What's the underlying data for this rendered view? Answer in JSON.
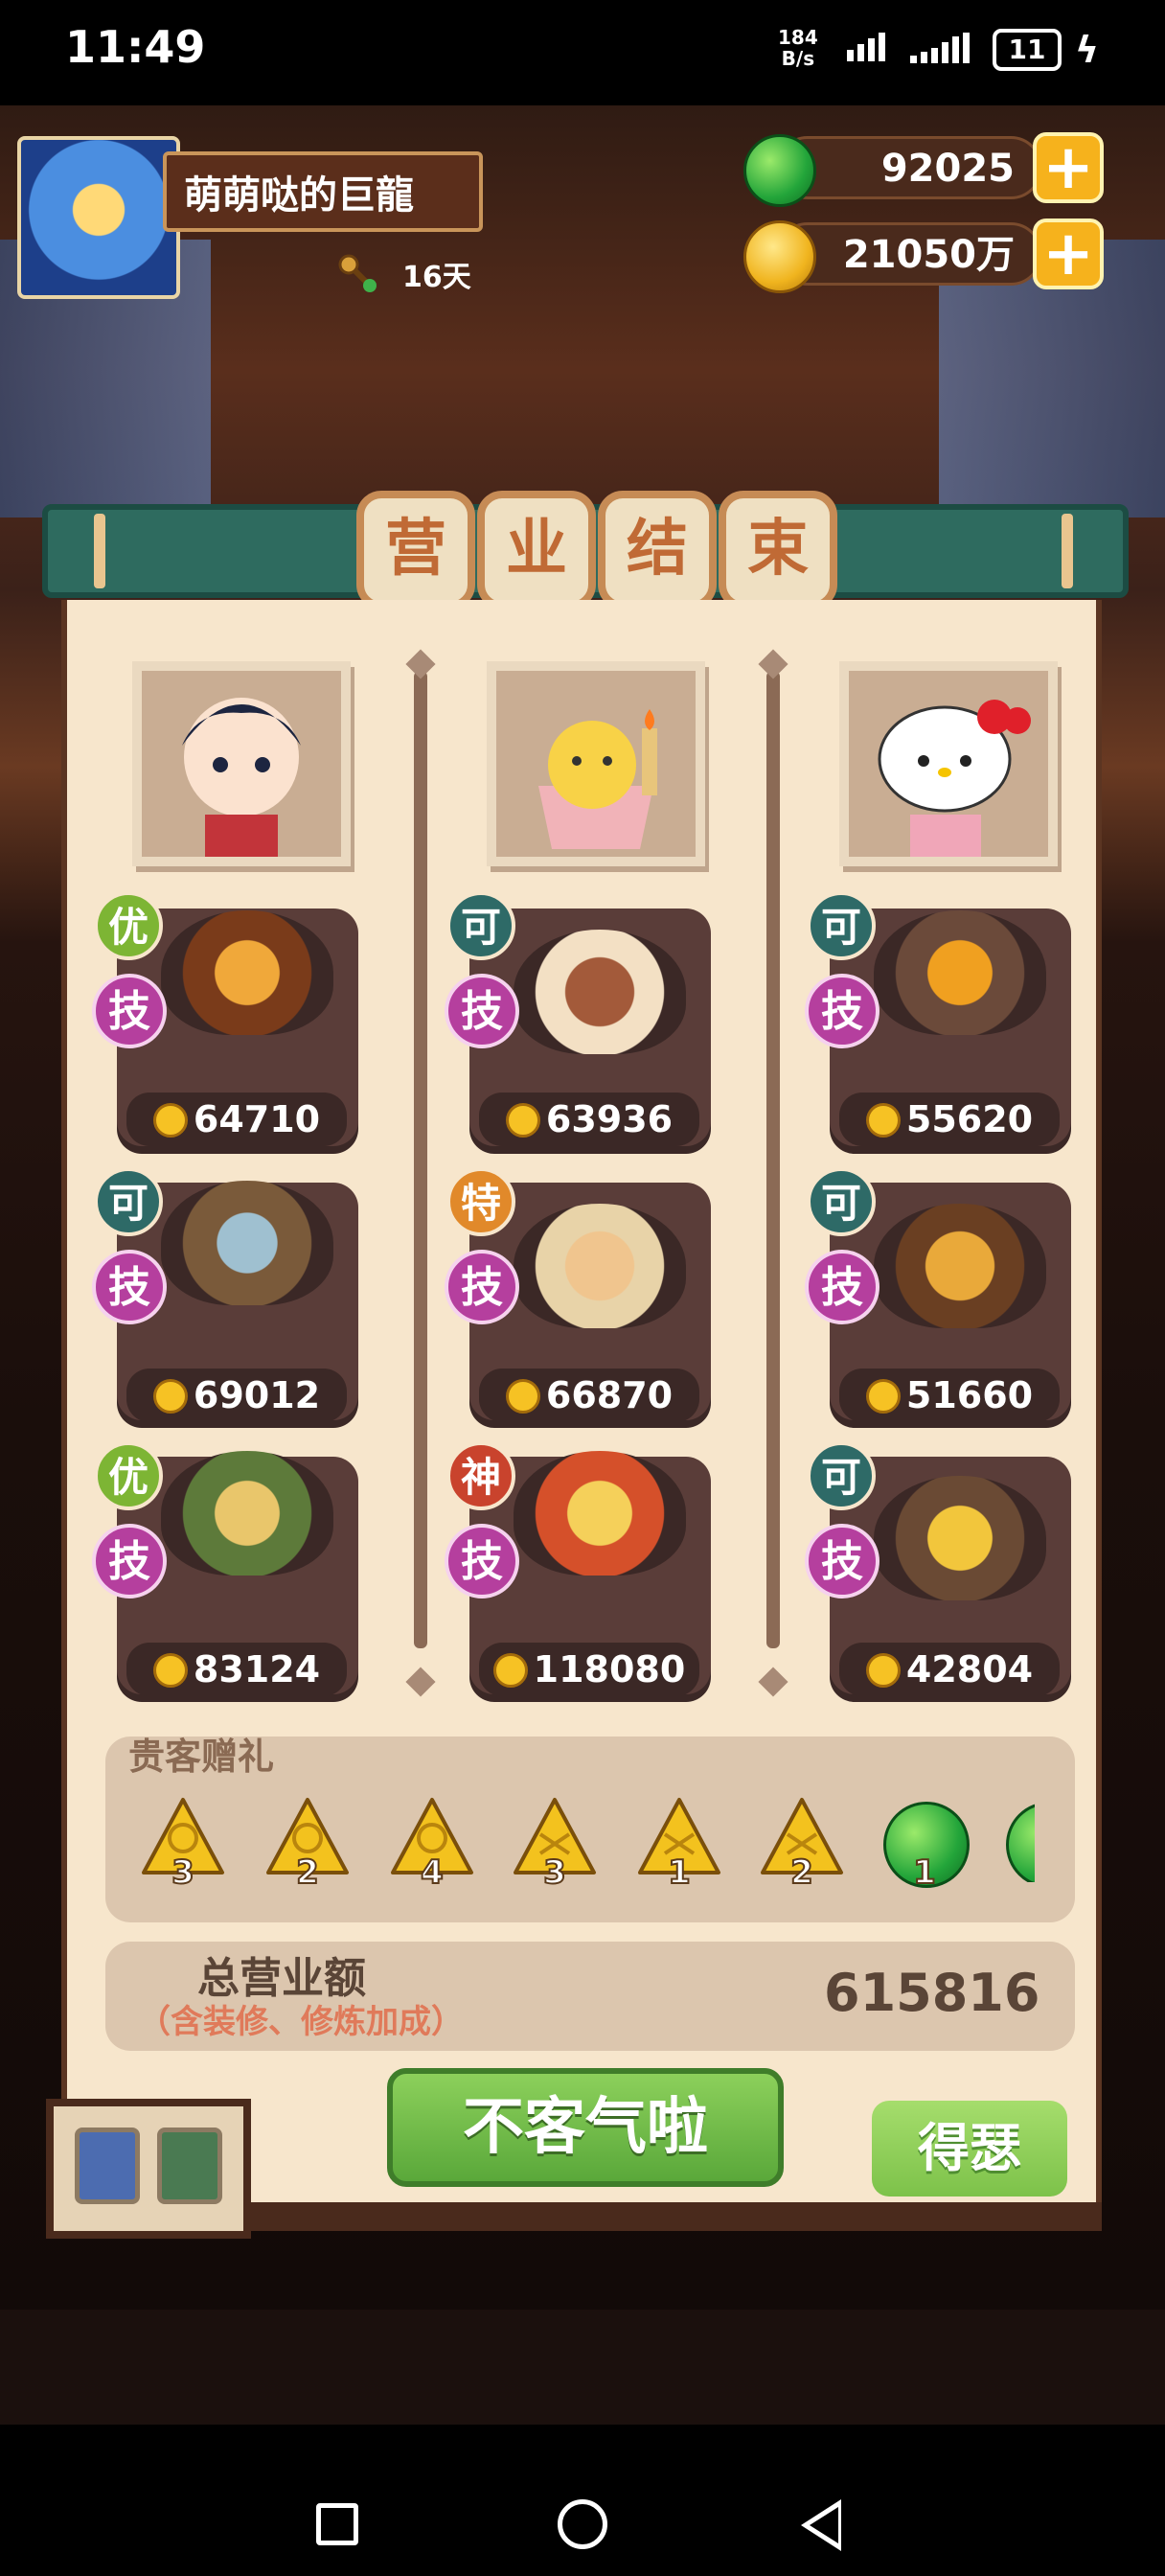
{
  "status_bar": {
    "time": "11:49",
    "net_speed_top": "184",
    "net_speed_unit": "B/s",
    "battery": "11"
  },
  "player": {
    "name": "萌萌哒的巨龍",
    "days": "16天"
  },
  "resources": {
    "jade": "92025",
    "coins": "21050万"
  },
  "title_chars": [
    "营",
    "业",
    "结",
    "束"
  ],
  "columns": [
    {
      "dishes": [
        {
          "grade": "优",
          "grade_color": "#7db534",
          "skill": "技",
          "price": "64710"
        },
        {
          "grade": "可",
          "grade_color": "#2e6a67",
          "skill": "技",
          "price": "69012"
        },
        {
          "grade": "优",
          "grade_color": "#7db534",
          "skill": "技",
          "price": "83124"
        }
      ]
    },
    {
      "dishes": [
        {
          "grade": "可",
          "grade_color": "#2e6a67",
          "skill": "技",
          "price": "63936"
        },
        {
          "grade": "特",
          "grade_color": "#e1892a",
          "skill": "技",
          "price": "66870"
        },
        {
          "grade": "神",
          "grade_color": "#c9432d",
          "skill": "技",
          "price": "118080"
        }
      ]
    },
    {
      "dishes": [
        {
          "grade": "可",
          "grade_color": "#2e6a67",
          "skill": "技",
          "price": "55620"
        },
        {
          "grade": "可",
          "grade_color": "#2e6a67",
          "skill": "技",
          "price": "51660"
        },
        {
          "grade": "可",
          "grade_color": "#2e6a67",
          "skill": "技",
          "price": "42804"
        }
      ]
    }
  ],
  "gifts": {
    "title": "贵客赠礼",
    "items": [
      "3",
      "2",
      "4",
      "3",
      "1",
      "2",
      "1"
    ]
  },
  "total": {
    "label": "总营业额",
    "sublabel": "（含装修、修炼加成）",
    "value": "615816"
  },
  "buttons": {
    "main": "不客气啦",
    "side": "得瑟"
  }
}
